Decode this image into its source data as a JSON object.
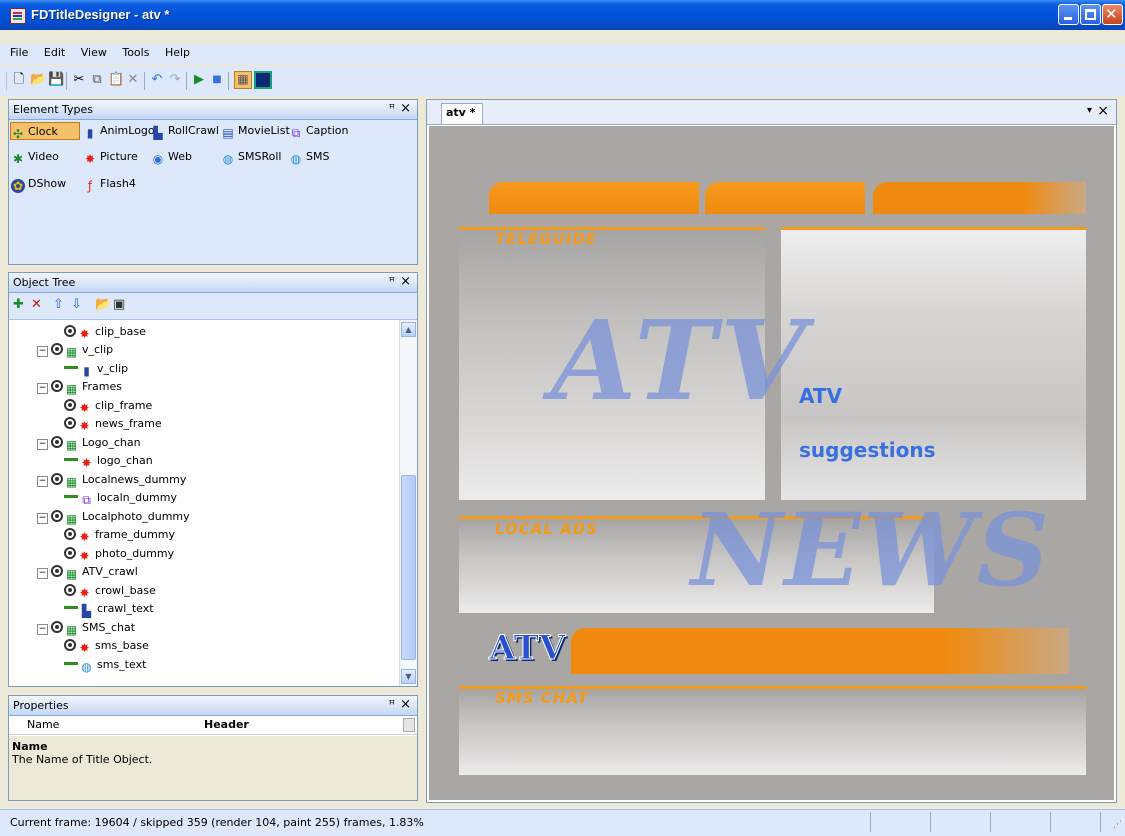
{
  "window": {
    "title": "FDTitleDesigner - atv *"
  },
  "menu": [
    "File",
    "Edit",
    "View",
    "Tools",
    "Help"
  ],
  "toolbar_icons": [
    "new-icon",
    "open-icon",
    "save-icon",
    "cut-icon",
    "copy-icon",
    "paste-icon",
    "delete-icon",
    "undo-icon",
    "redo-icon",
    "play-icon",
    "stop-icon",
    "grid-icon",
    "safe-area-icon"
  ],
  "element_types": {
    "title": "Element Types",
    "items": [
      "Clock",
      "AnimLogo",
      "RollCrawl",
      "MovieList",
      "Caption",
      "Video",
      "Picture",
      "Web",
      "SMSRoll",
      "SMS",
      "DShow",
      "Flash4"
    ],
    "selected": "Clock"
  },
  "object_tree": {
    "title": "Object Tree",
    "nodes": [
      {
        "label": "clip_base"
      },
      {
        "label": "v_clip"
      },
      {
        "label": "v_clip"
      },
      {
        "label": "Frames"
      },
      {
        "label": "clip_frame"
      },
      {
        "label": "news_frame"
      },
      {
        "label": "Logo_chan"
      },
      {
        "label": "logo_chan"
      },
      {
        "label": "Localnews_dummy"
      },
      {
        "label": "localn_dummy"
      },
      {
        "label": "Localphoto_dummy"
      },
      {
        "label": "frame_dummy"
      },
      {
        "label": "photo_dummy"
      },
      {
        "label": "ATV_crawl"
      },
      {
        "label": "crowl_base"
      },
      {
        "label": "crawl_text"
      },
      {
        "label": "SMS_chat"
      },
      {
        "label": "sms_base"
      },
      {
        "label": "sms_text"
      }
    ]
  },
  "properties": {
    "title": "Properties",
    "row_name": "Name",
    "row_value": "Header",
    "desc_title": "Name",
    "desc_text": "The Name of Title Object."
  },
  "document": {
    "tab": "atv *",
    "canvas": {
      "teleguide": "TELEGUIDE",
      "local_ads": "LOCAL ADS",
      "sms_chat": "SMS CHAT",
      "watermark_atv": "ATV",
      "watermark_news": "NEWS",
      "atv_text": "ATV",
      "suggestions_text": "suggestions",
      "logo": "ATV"
    }
  },
  "status": {
    "text": "Current frame: 19604 / skipped 359 (render 104, paint 255) frames, 1.83%"
  },
  "colors": {
    "accent_orange": "#f08a0e",
    "titlebar_blue": "#0050d8",
    "panel_bg": "#dde9fb"
  }
}
